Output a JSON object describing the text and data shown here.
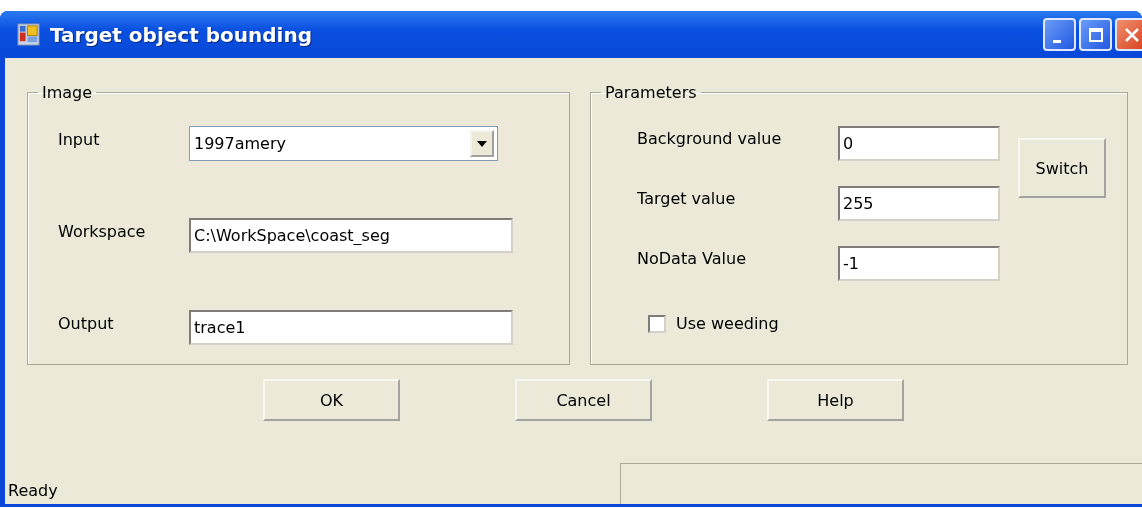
{
  "window": {
    "title": "Target object bounding"
  },
  "image_group": {
    "label": "Image",
    "input": {
      "label": "Input",
      "value": "1997amery"
    },
    "workspace": {
      "label": "Workspace",
      "value": "C:\\WorkSpace\\coast_seg"
    },
    "output": {
      "label": "Output",
      "value": "trace1"
    }
  },
  "parameters_group": {
    "label": "Parameters",
    "fields": [
      {
        "label": "Background value",
        "value": "0"
      },
      {
        "label": "Target value",
        "value": "255"
      },
      {
        "label": "NoData Value",
        "value": "-1"
      }
    ],
    "switch_button": "Switch",
    "use_weeding": {
      "label": "Use weeding",
      "checked": false
    }
  },
  "buttons": [
    "OK",
    "Cancel",
    "Help"
  ],
  "status_bar": {
    "text": "Ready"
  }
}
